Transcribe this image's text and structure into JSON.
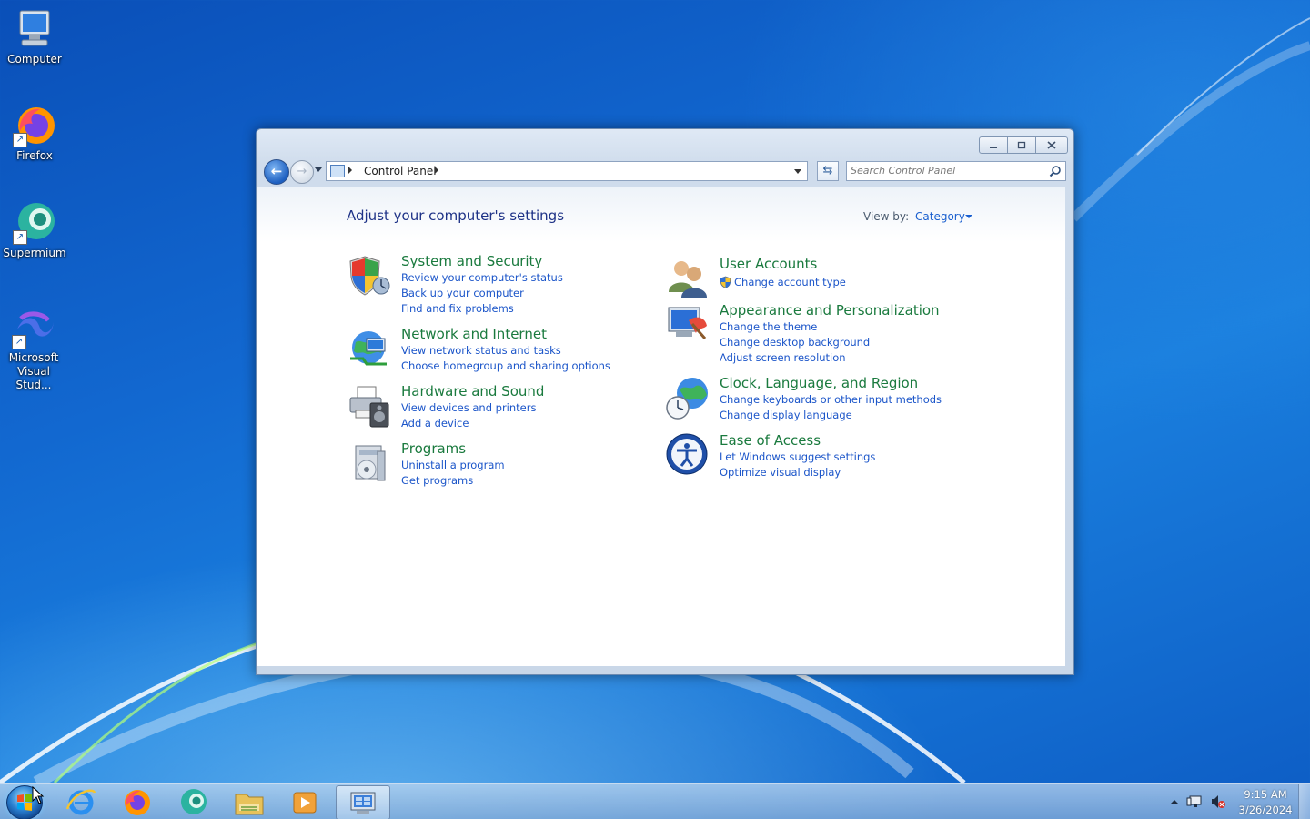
{
  "desktop": {
    "icons": [
      {
        "label": "Computer"
      },
      {
        "label": "Firefox"
      },
      {
        "label": "Supermium"
      },
      {
        "label_line1": "Microsoft",
        "label_line2": "Visual Stud..."
      }
    ]
  },
  "window": {
    "breadcrumb": "Control Panel",
    "search_placeholder": "Search Control Panel",
    "page_title": "Adjust your computer's settings",
    "view_by_label": "View by:",
    "view_by_value": "Category",
    "categories": [
      {
        "title": "System and Security",
        "links": [
          "Review your computer's status",
          "Back up your computer",
          "Find and fix problems"
        ]
      },
      {
        "title": "Network and Internet",
        "links": [
          "View network status and tasks",
          "Choose homegroup and sharing options"
        ]
      },
      {
        "title": "Hardware and Sound",
        "links": [
          "View devices and printers",
          "Add a device"
        ]
      },
      {
        "title": "Programs",
        "links": [
          "Uninstall a program",
          "Get programs"
        ]
      },
      {
        "title": "User Accounts",
        "links": [
          "Change account type"
        ]
      },
      {
        "title": "Appearance and Personalization",
        "links": [
          "Change the theme",
          "Change desktop background",
          "Adjust screen resolution"
        ]
      },
      {
        "title": "Clock, Language, and Region",
        "links": [
          "Change keyboards or other input methods",
          "Change display language"
        ]
      },
      {
        "title": "Ease of Access",
        "links": [
          "Let Windows suggest settings",
          "Optimize visual display"
        ]
      }
    ]
  },
  "taskbar": {
    "pinned": [
      "start-button",
      "internet-explorer-icon",
      "firefox-icon",
      "supermium-icon",
      "file-explorer-icon",
      "media-player-icon",
      "control-panel-icon"
    ],
    "clock_time": "9:15 AM",
    "clock_date": "3/26/2024"
  },
  "colors": {
    "category_title": "#1a7a3e",
    "link": "#1b55c9",
    "page_title": "#1e3287"
  }
}
